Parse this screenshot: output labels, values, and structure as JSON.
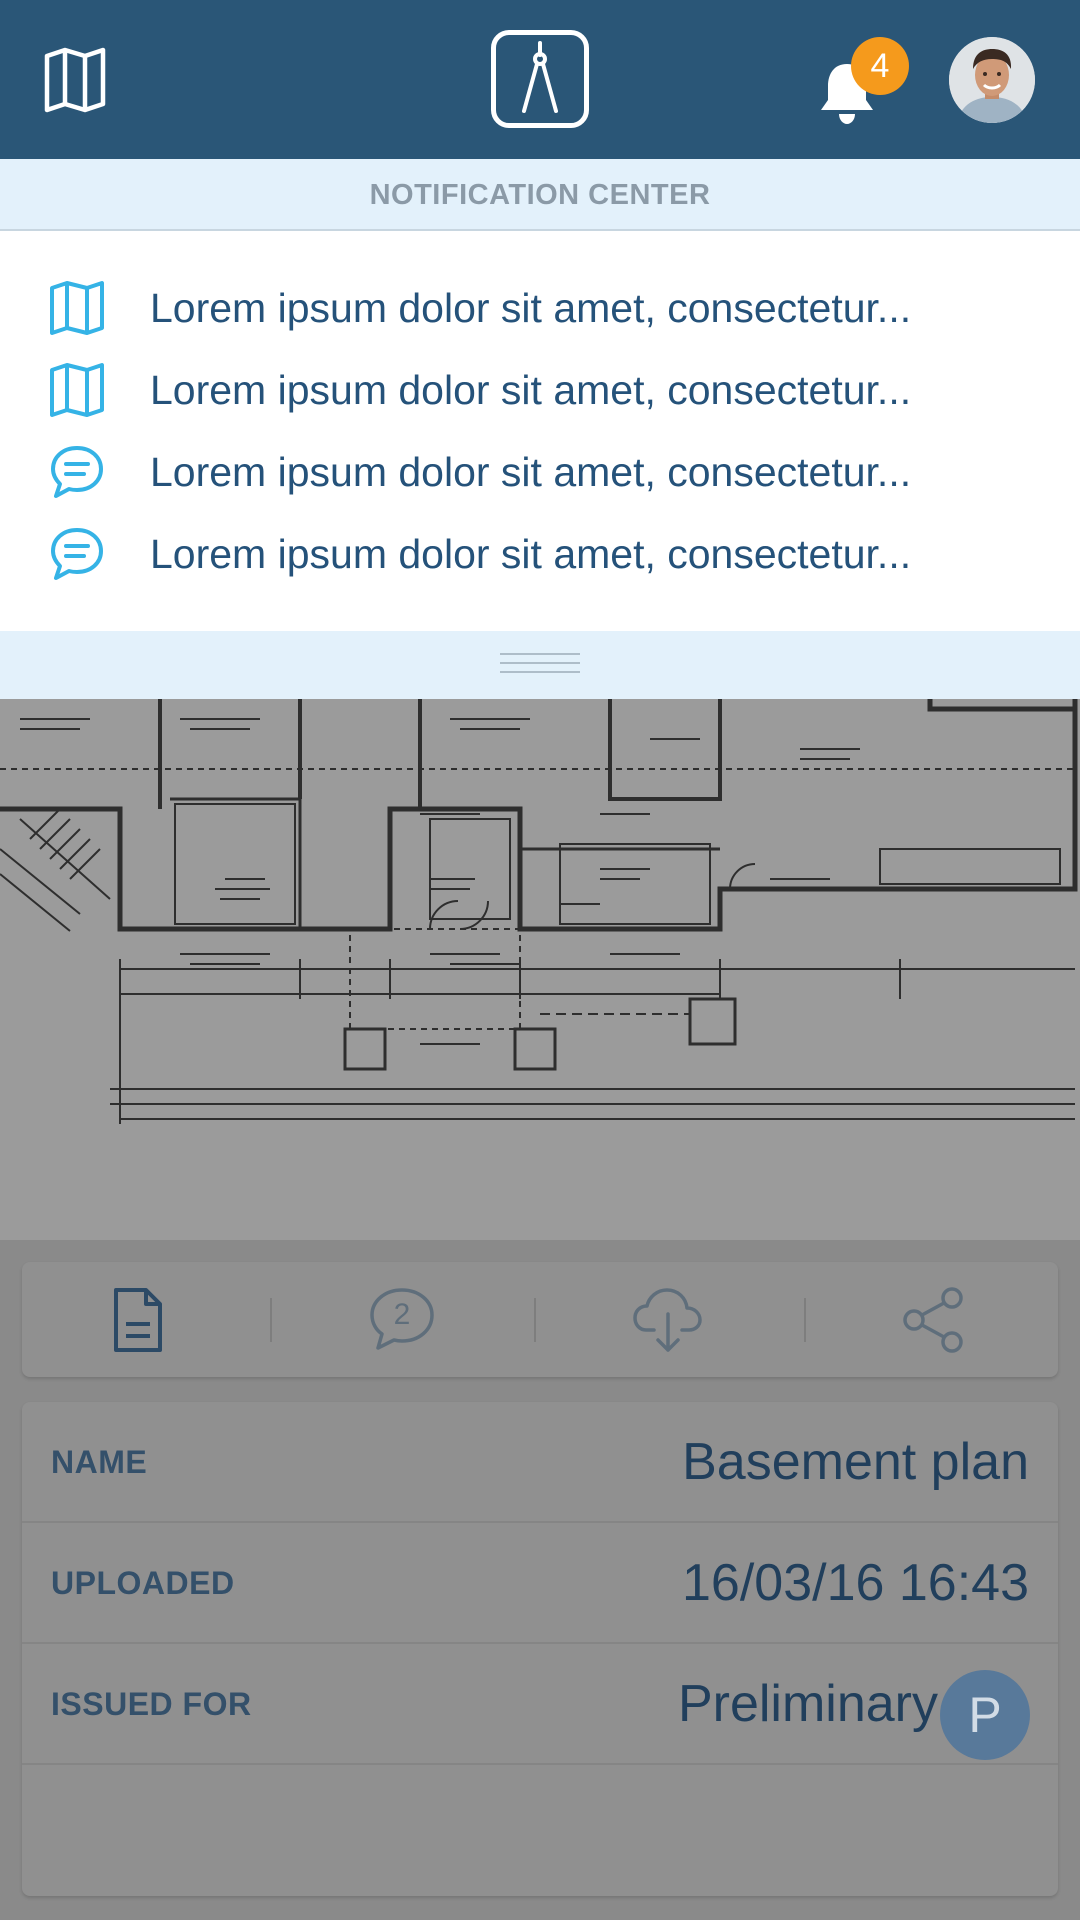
{
  "header": {
    "map_icon": "map-icon",
    "logo_icon": "compass-drafting-icon",
    "bell_icon": "bell-icon",
    "notification_count": "4",
    "avatar": "user-avatar"
  },
  "notification_center": {
    "title": "NOTIFICATION CENTER",
    "items": [
      {
        "icon": "map-icon",
        "text": "Lorem ipsum dolor sit amet, consectetur..."
      },
      {
        "icon": "map-icon",
        "text": "Lorem ipsum dolor sit amet, consectetur..."
      },
      {
        "icon": "chat-bubble-icon",
        "text": "Lorem ipsum dolor sit amet, consectetur..."
      },
      {
        "icon": "chat-bubble-icon",
        "text": "Lorem ipsum dolor sit amet, consectetur..."
      }
    ]
  },
  "actions": {
    "document_icon": "document-icon",
    "comments_icon": "comment-icon",
    "comments_count": "2",
    "download_icon": "cloud-download-icon",
    "share_icon": "share-icon"
  },
  "details": {
    "name_label": "NAME",
    "name_value": "Basement plan",
    "uploaded_label": "UPLOADED",
    "uploaded_value": "16/03/16 16:43",
    "issued_label": "ISSUED FOR",
    "issued_value": "Preliminary",
    "issued_badge": "P"
  },
  "colors": {
    "header_bg": "#2a5677",
    "badge": "#f59a1c",
    "notification_text": "#25527a",
    "icon_accent": "#35b3e6",
    "panel_bg": "#e3f1fb"
  }
}
